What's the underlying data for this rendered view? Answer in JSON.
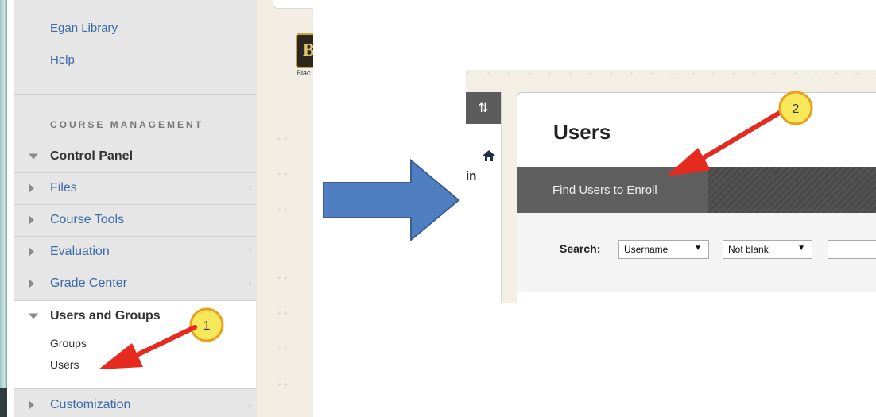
{
  "left_panel": {
    "links": [
      "Egan Library",
      "Help"
    ],
    "section_heading": "COURSE MANAGEMENT",
    "control_panel_label": "Control Panel",
    "items": [
      {
        "label": "Files",
        "has_submenu": true
      },
      {
        "label": "Course Tools",
        "has_submenu": false
      },
      {
        "label": "Evaluation",
        "has_submenu": true
      },
      {
        "label": "Grade Center",
        "has_submenu": true
      }
    ],
    "users_and_groups": {
      "label": "Users and Groups",
      "sub_items": [
        "Groups",
        "Users"
      ]
    },
    "customization_label": "Customization",
    "tool_caption": "Blac"
  },
  "callouts": {
    "step1": "1",
    "step2": "2"
  },
  "right_panel": {
    "page_title": "Users",
    "toggle_icon": "⇅",
    "truncated_label": "in",
    "tab_label": "Find Users to Enroll",
    "search_label": "Search:",
    "field_select": "Username",
    "condition_select": "Not blank",
    "dropdown_glyph": "▼"
  },
  "colors": {
    "link_blue": "#3a6aa8",
    "callout_yellow": "#f6e85a",
    "callout_orange_border": "#e6a11e",
    "annotation_red": "#e52a20",
    "flow_arrow_blue": "#4f7fc0"
  }
}
